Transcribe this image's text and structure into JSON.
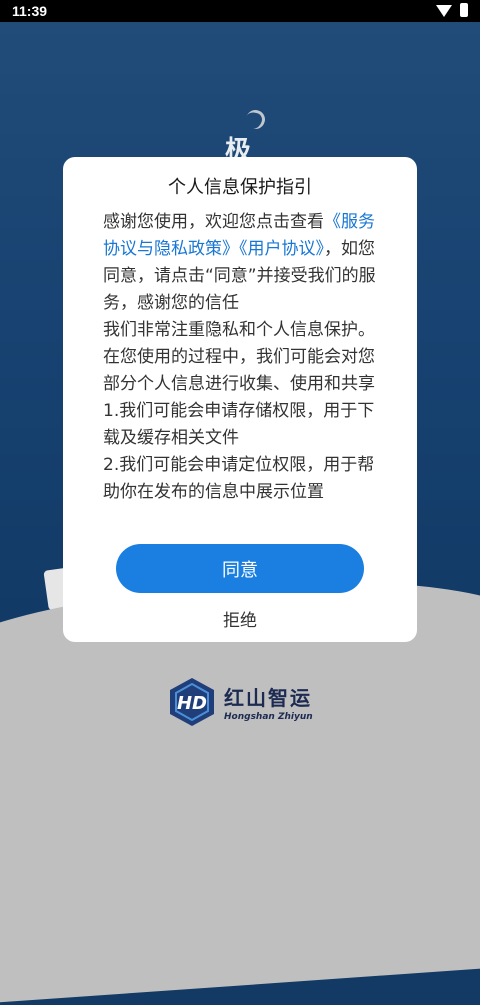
{
  "status_bar": {
    "time": "11:39"
  },
  "splash": {
    "partial_char": "极",
    "logo_cn": "红山智运",
    "logo_en": "Hongshan Zhiyun"
  },
  "dialog": {
    "title": "个人信息保护指引",
    "p1_prefix": "感谢您使用，欢迎您点击查看",
    "link_service_privacy": "《服务协议与隐私政策》",
    "link_user_agreement": "《用户协议》",
    "p1_suffix": "，如您同意，请点击“同意”并接受我们的服务，感谢您的信任",
    "p2": "我们非常注重隐私和个人信息保护。在您使用的过程中，我们可能会对您部分个人信息进行收集、使用和共享",
    "p3": "1.我们可能会申请存储权限，用于下载及缓存相关文件",
    "p4": "2.我们可能会申请定位权限，用于帮助你在发布的信息中展示位置",
    "agree_label": "同意",
    "reject_label": "拒绝"
  },
  "colors": {
    "primary": "#1a7fe0",
    "link": "#1877d4",
    "background": "#174271"
  }
}
